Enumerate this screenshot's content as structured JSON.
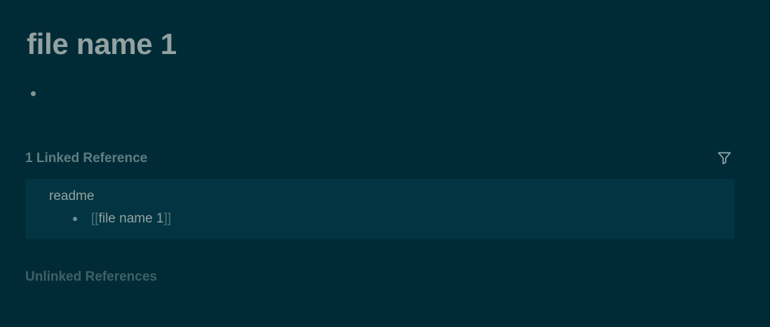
{
  "page": {
    "title": "file name 1"
  },
  "linked_references": {
    "header": "1 Linked Reference",
    "filter_icon": "filter-icon",
    "items": [
      {
        "page_name": "readme",
        "block": {
          "open_bracket": "[[",
          "link_text": "file name 1",
          "close_bracket": "]]"
        }
      }
    ]
  },
  "unlinked_references": {
    "header": "Unlinked References"
  },
  "colors": {
    "background": "#002b36",
    "card_background": "#023541",
    "title_text": "#93a1a1",
    "muted_header": "#5f7d82"
  }
}
